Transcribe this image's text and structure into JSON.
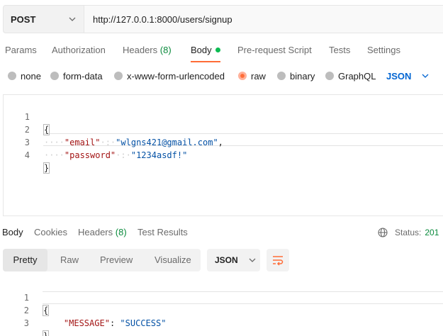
{
  "request": {
    "method": "POST",
    "url": "http://127.0.0.1:8000/users/signup"
  },
  "request_tabs": {
    "params": "Params",
    "authorization": "Authorization",
    "headers": "Headers",
    "headers_count": "(8)",
    "body": "Body",
    "prerequest": "Pre-request Script",
    "tests": "Tests",
    "settings": "Settings"
  },
  "body_types": {
    "none": "none",
    "form_data": "form-data",
    "urlencoded": "x-www-form-urlencoded",
    "raw": "raw",
    "binary": "binary",
    "graphql": "GraphQL",
    "selected": "raw",
    "language": "JSON"
  },
  "request_body": {
    "lines": [
      {
        "num": "1",
        "open": "{"
      },
      {
        "num": "2",
        "indent": "····",
        "key": "\"email\"",
        "sep": "·:·",
        "value": "\"wlgns421@gmail.com\"",
        "tail": ","
      },
      {
        "num": "3",
        "indent": "····",
        "key": "\"password\"",
        "sep": "·:·",
        "value": "\"1234asdf!\""
      },
      {
        "num": "4",
        "close": "}"
      }
    ]
  },
  "response_tabs": {
    "body": "Body",
    "cookies": "Cookies",
    "headers": "Headers",
    "headers_count": "(8)",
    "test_results": "Test Results"
  },
  "response_status": {
    "label": "Status:",
    "code": "201"
  },
  "view_modes": {
    "pretty": "Pretty",
    "raw": "Raw",
    "preview": "Preview",
    "visualize": "Visualize",
    "selected": "Pretty"
  },
  "response_format": "JSON",
  "response_body": {
    "lines": [
      {
        "num": "1",
        "open": "{"
      },
      {
        "num": "2",
        "indent": "    ",
        "key": "\"MESSAGE\"",
        "sep": ": ",
        "value": "\"SUCCESS\""
      },
      {
        "num": "3",
        "close": "}"
      }
    ]
  },
  "colors": {
    "accent": "#ff6c37",
    "link": "#0265d2",
    "success": "#0a8a3c",
    "json_key": "#a31515",
    "json_string": "#0451a5"
  },
  "icons": {
    "method_dropdown": "chevron-down-icon",
    "language_dropdown": "chevron-down-icon",
    "status_globe": "globe-icon",
    "format_dropdown": "chevron-down-icon",
    "wrap": "wrap-lines-icon"
  }
}
